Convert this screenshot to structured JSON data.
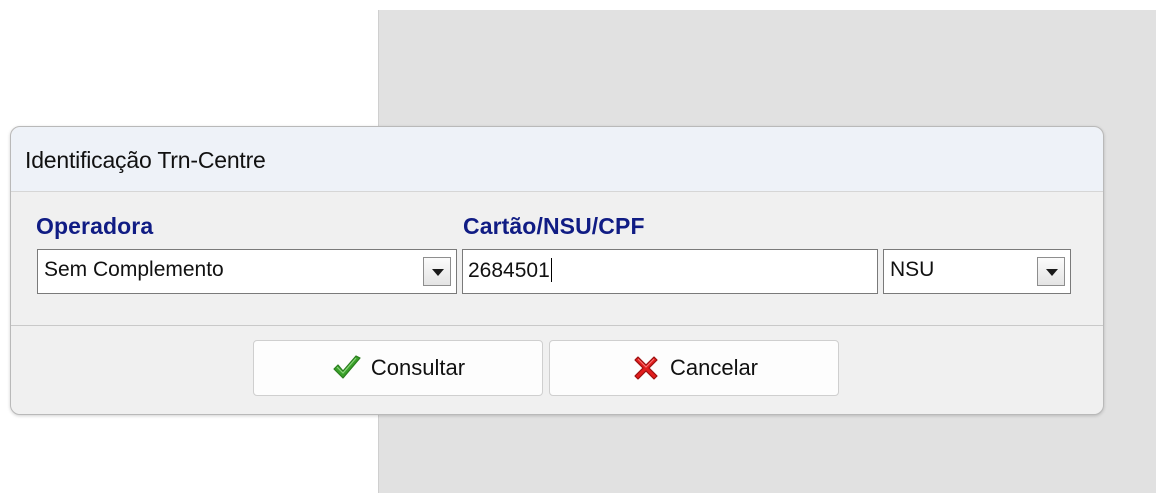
{
  "dialog": {
    "title": "Identificação Trn-Centre"
  },
  "fields": {
    "operadora_label": "Operadora",
    "cartao_label": "Cartão/NSU/CPF",
    "operadora_value": "Sem Complemento",
    "cartao_value": "2684501",
    "tipo_value": "NSU"
  },
  "buttons": {
    "consultar_label": "Consultar",
    "cancelar_label": "Cancelar"
  },
  "icons": {
    "consultar_icon": "checkmark-icon",
    "cancelar_icon": "red-x-icon",
    "dropdown_icon": "chevron-down-icon"
  },
  "colors": {
    "label_color": "#101c84",
    "check_green": "#3aa12a",
    "cancel_red": "#e11d1d"
  }
}
